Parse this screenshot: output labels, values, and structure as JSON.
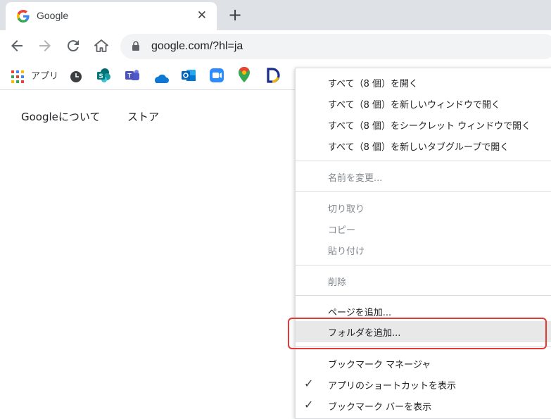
{
  "tab": {
    "title": "Google",
    "close": "✕"
  },
  "newtab": "+",
  "omnibox": {
    "url": "google.com/?hl=ja"
  },
  "bookmarks": {
    "apps_label": "アプリ"
  },
  "page": {
    "about": "Googleについて",
    "store": "ストア"
  },
  "menu": {
    "open_all": "すべて（8 個）を開く",
    "open_all_new_window": "すべて（8 個）を新しいウィンドウで開く",
    "open_all_incognito": "すべて（8 個）をシークレット ウィンドウで開く",
    "open_all_tab_group": "すべて（8 個）を新しいタブグループで開く",
    "rename": "名前を変更...",
    "cut": "切り取り",
    "copy": "コピー",
    "paste": "貼り付け",
    "delete": "削除",
    "add_page": "ページを追加...",
    "add_folder": "フォルダを追加...",
    "bookmark_manager": "ブックマーク マネージャ",
    "show_app_shortcuts": "アプリのショートカットを表示",
    "show_bookmark_bar": "ブックマーク バーを表示",
    "check_mark": "✓"
  },
  "colors": {
    "highlight": "#e53935",
    "tabstrip": "#dee1e6",
    "omnibox": "#f1f3f4"
  }
}
